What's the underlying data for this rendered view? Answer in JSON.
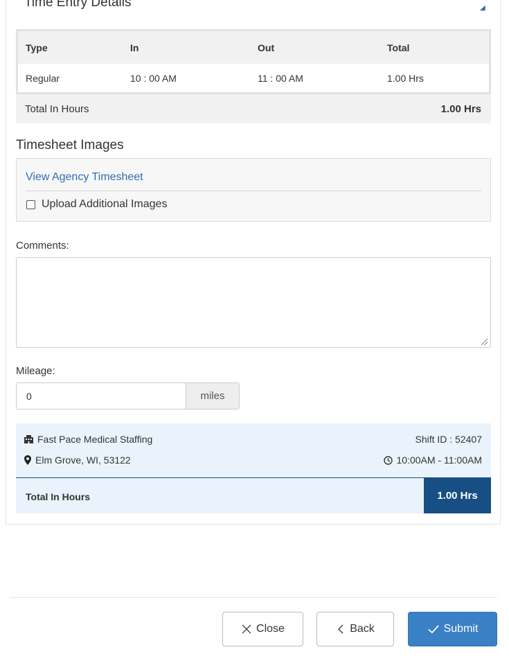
{
  "section": {
    "title": "Time Entry Details"
  },
  "entry_table": {
    "headers": [
      "Type",
      "In",
      "Out",
      "Total"
    ],
    "rows": [
      {
        "type": "Regular",
        "in": "10 : 00 AM",
        "out": "11 : 00 AM",
        "total": "1.00 Hrs"
      }
    ],
    "total_label": "Total In Hours",
    "total_value": "1.00 Hrs"
  },
  "images": {
    "title": "Timesheet Images",
    "view_link": "View Agency Timesheet",
    "upload_label": "Upload Additional Images",
    "upload_checked": false
  },
  "comments": {
    "label": "Comments:",
    "value": ""
  },
  "mileage": {
    "label": "Mileage:",
    "value": "0",
    "unit": "miles"
  },
  "summary": {
    "agency": "Fast Pace Medical Staffing",
    "location": "Elm Grove, WI, 53122",
    "shift_id": "Shift ID : 52407",
    "shift_time": "10:00AM - 11:00AM",
    "total_label": "Total In Hours",
    "total_value": "1.00 Hrs"
  },
  "buttons": {
    "close": "Close",
    "back": "Back",
    "submit": "Submit"
  },
  "colors": {
    "accent": "#3a80c4",
    "summary_bg": "#eaf3fb",
    "total_badge": "#174f85",
    "link": "#2f6fae"
  }
}
